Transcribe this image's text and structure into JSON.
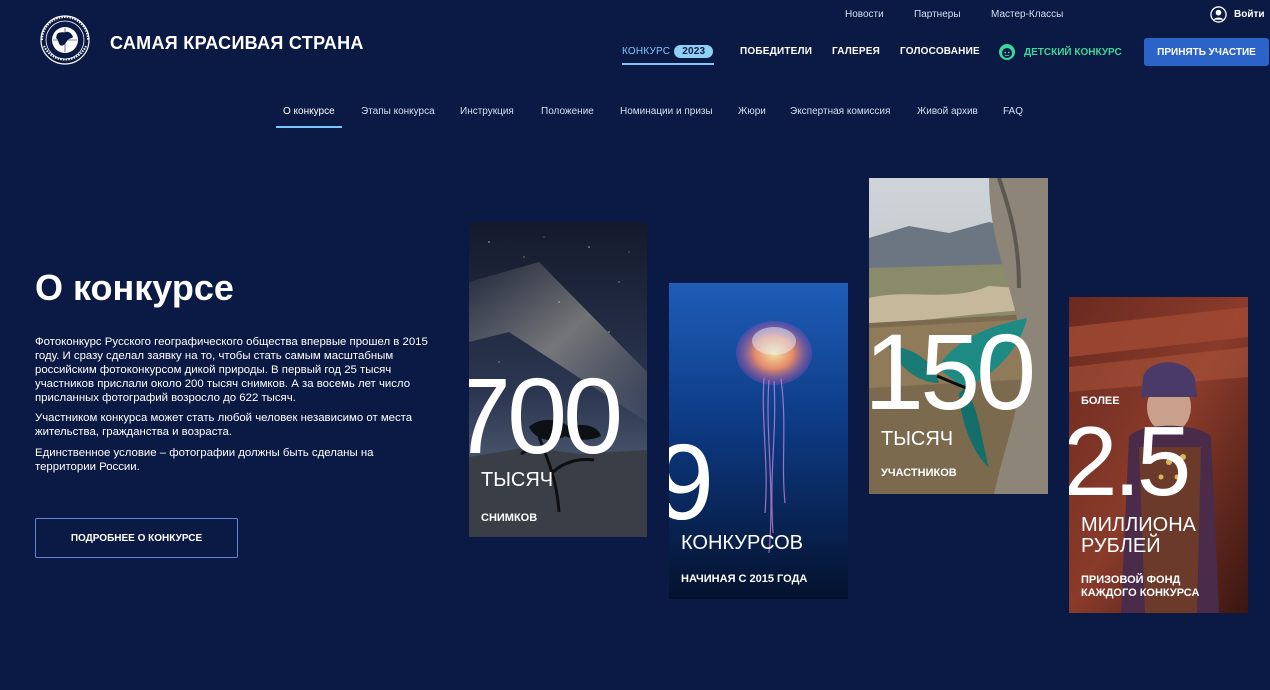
{
  "top_links": [
    "Новости",
    "Партнеры",
    "Мастер-Классы"
  ],
  "login_label": "Войти",
  "brand": "САМАЯ КРАСИВАЯ СТРАНА",
  "nav": {
    "contest": "КОНКУРС",
    "year": "2023",
    "winners": "ПОБЕДИТЕЛИ",
    "gallery": "ГАЛЕРЕЯ",
    "voting": "ГОЛОСОВАНИЕ",
    "kids": "ДЕТСКИЙ КОНКУРС",
    "cta": "ПРИНЯТЬ УЧАСТИЕ"
  },
  "subnav": [
    "О конкурсе",
    "Этапы конкурса",
    "Инструкция",
    "Положение",
    "Номинации и призы",
    "Жюри",
    "Экспертная комиссия",
    "Живой архив",
    "FAQ"
  ],
  "page_title": "О конкурсе",
  "paragraphs": [
    "Фотоконкурс Русского географического общества впервые прошел в 2015 году. И сразу сделал заявку на то, чтобы стать самым масштабным российским фотоконкурсом дикой природы. В первый год 25 тысяч участников прислали около 200 тысяч снимков. А за восемь лет число присланных фотографий возросло до 622 тысяч.",
    "Участником конкурса может стать любой человек независимо от места жительства, гражданства и возраста.",
    "Единственное условие – фотографии должны быть сделаны на территории России."
  ],
  "more_button": "ПОДРОБНЕЕ О КОНКУРСЕ",
  "stats": [
    {
      "number": "700",
      "label": "ТЫСЯЧ",
      "sub": "СНИМКОВ"
    },
    {
      "number": "9",
      "label": "КОНКУРСОВ",
      "sub": "НАЧИНАЯ С 2015 ГОДА"
    },
    {
      "number": "150",
      "label": "ТЫСЯЧ",
      "sub": "УЧАСТНИКОВ"
    },
    {
      "prefix": "БОЛЕЕ",
      "number": "2.5",
      "label_line1": "МИЛЛИОНА",
      "label_line2": "РУБЛЕЙ",
      "sub_line1": "ПРИЗОВОЙ ФОНД",
      "sub_line2": "КАЖДОГО КОНКУРСА"
    }
  ],
  "colors": {
    "background": "#0b1a45",
    "accent_blue": "#7fc6ff",
    "cta_blue": "#2b63c8",
    "kids_green": "#3ed59a"
  },
  "icons": [
    "user-icon",
    "rgo-logo",
    "kids-icon"
  ]
}
